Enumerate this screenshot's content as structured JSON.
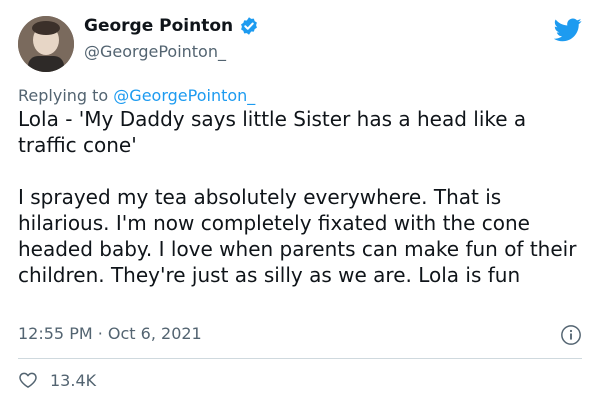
{
  "author": {
    "display_name": "George Pointon",
    "handle": "@GeorgePointon_"
  },
  "reply": {
    "prefix": "Replying to ",
    "mention": "@GeorgePointon_"
  },
  "tweet": {
    "paragraphs": [
      "Lola - 'My Daddy says little Sister has a head like a traffic cone'",
      "I sprayed my tea absolutely everywhere. That is hilarious. I'm now completely fixated with the cone headed baby. I love when parents can make fun of their children. They're just as silly as we are. Lola is fun"
    ],
    "timestamp": "12:55 PM · Oct 6, 2021"
  },
  "engagement": {
    "likes": "13.4K"
  },
  "icons": {
    "verified": "verified-badge-icon",
    "brand": "twitter-bird-icon",
    "info": "info-icon",
    "like": "heart-icon"
  },
  "colors": {
    "brand_blue": "#1d9bf0",
    "secondary_text": "#536471",
    "primary_text": "#0f1419",
    "divider": "#cfd9de"
  }
}
